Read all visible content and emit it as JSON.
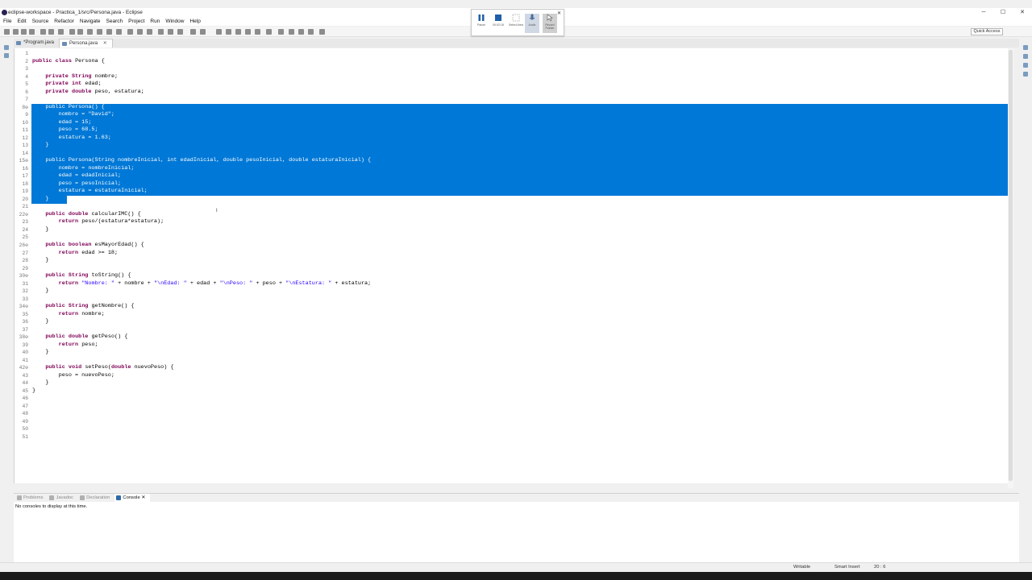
{
  "window": {
    "title": "eclipse-workspace - Practica_1/src/Persona.java - Eclipse"
  },
  "menu": [
    "File",
    "Edit",
    "Source",
    "Refactor",
    "Navigate",
    "Search",
    "Project",
    "Run",
    "Window",
    "Help"
  ],
  "toolbar": {
    "quick_access": "Quick Access"
  },
  "recorder": {
    "pause_label": "Pause",
    "timer": "00:02:18",
    "btn3": "Select Area",
    "btn4": "Audio",
    "btn5": "Record Pointer"
  },
  "editor_tabs": [
    {
      "label": "*Program.java",
      "active": false
    },
    {
      "label": "Persona.java",
      "active": true
    }
  ],
  "code": [
    {
      "n": "1",
      "t": ""
    },
    {
      "n": "2",
      "t": "public class Persona {"
    },
    {
      "n": "3",
      "t": ""
    },
    {
      "n": "4",
      "t": "    private String nombre;"
    },
    {
      "n": "5",
      "t": "    private int edad;"
    },
    {
      "n": "6",
      "t": "    private double peso, estatura;"
    },
    {
      "n": "7",
      "t": ""
    },
    {
      "n": "8⊖",
      "t": "    public Persona() {"
    },
    {
      "n": "9",
      "t": "        nombre = \"David\";"
    },
    {
      "n": "10",
      "t": "        edad = 15;"
    },
    {
      "n": "11",
      "t": "        peso = 68.5;"
    },
    {
      "n": "12",
      "t": "        estatura = 1.63;"
    },
    {
      "n": "13",
      "t": "    }"
    },
    {
      "n": "14",
      "t": ""
    },
    {
      "n": "15⊖",
      "t": "    public Persona(String nombreInicial, int edadInicial, double pesoInicial, double estaturaInicial) {"
    },
    {
      "n": "16",
      "t": "        nombre = nombreInicial;"
    },
    {
      "n": "17",
      "t": "        edad = edadInicial;"
    },
    {
      "n": "18",
      "t": "        peso = pesoInicial;"
    },
    {
      "n": "19",
      "t": "        estatura = estaturaInicial;"
    },
    {
      "n": "20",
      "t": "    }"
    },
    {
      "n": "21",
      "t": ""
    },
    {
      "n": "22⊖",
      "t": "    public double calcularIMC() {"
    },
    {
      "n": "23",
      "t": "        return peso/(estatura*estatura);"
    },
    {
      "n": "24",
      "t": "    }"
    },
    {
      "n": "25",
      "t": ""
    },
    {
      "n": "26⊖",
      "t": "    public boolean esMayorEdad() {"
    },
    {
      "n": "27",
      "t": "        return edad >= 18;"
    },
    {
      "n": "28",
      "t": "    }"
    },
    {
      "n": "29",
      "t": ""
    },
    {
      "n": "30⊖",
      "t": "    public String toString() {"
    },
    {
      "n": "31",
      "t": "        return \"Nombre: \" + nombre + \"\\nEdad: \" + edad + \"\\nPeso: \" + peso + \"\\nEstatura: \" + estatura;"
    },
    {
      "n": "32",
      "t": "    }"
    },
    {
      "n": "33",
      "t": ""
    },
    {
      "n": "34⊖",
      "t": "    public String getNombre() {"
    },
    {
      "n": "35",
      "t": "        return nombre;"
    },
    {
      "n": "36",
      "t": "    }"
    },
    {
      "n": "37",
      "t": ""
    },
    {
      "n": "38⊖",
      "t": "    public double getPeso() {"
    },
    {
      "n": "39",
      "t": "        return peso;"
    },
    {
      "n": "40",
      "t": "    }"
    },
    {
      "n": "41",
      "t": ""
    },
    {
      "n": "42⊖",
      "t": "    public void setPeso(double nuevoPeso) {"
    },
    {
      "n": "43",
      "t": "        peso = nuevoPeso;"
    },
    {
      "n": "44",
      "t": "    }"
    },
    {
      "n": "45",
      "t": "}"
    },
    {
      "n": "46",
      "t": ""
    },
    {
      "n": "47",
      "t": ""
    },
    {
      "n": "48",
      "t": ""
    },
    {
      "n": "49",
      "t": ""
    },
    {
      "n": "50",
      "t": ""
    },
    {
      "n": "51",
      "t": ""
    }
  ],
  "selection": {
    "from_line": 8,
    "to_line": 20,
    "color": "#0078d7"
  },
  "bottom_tabs": [
    {
      "label": "Problems",
      "active": false
    },
    {
      "label": "Javadoc",
      "active": false
    },
    {
      "label": "Declaration",
      "active": false
    },
    {
      "label": "Console",
      "active": true
    }
  ],
  "console": {
    "message": "No consoles to display at this time."
  },
  "status": {
    "writable": "Writable",
    "insert_mode": "Smart Insert",
    "position": "20 : 6"
  },
  "colors": {
    "keyword": "#7f0055",
    "field": "#0000c0",
    "string": "#2a00ff",
    "selection_text": "#ffffff"
  }
}
